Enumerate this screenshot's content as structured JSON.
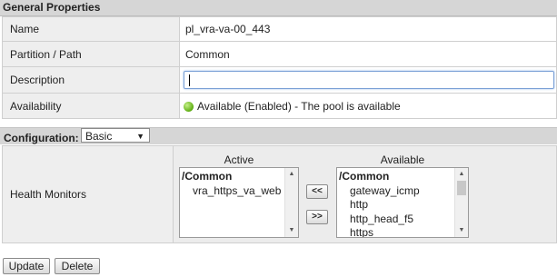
{
  "general": {
    "title": "General Properties",
    "rows": [
      {
        "label": "Name",
        "value": "pl_vra-va-00_443"
      },
      {
        "label": "Partition / Path",
        "value": "Common"
      },
      {
        "label": "Description",
        "value": ""
      },
      {
        "label": "Availability",
        "value": "Available (Enabled) - The pool is available"
      }
    ]
  },
  "configuration": {
    "label": "Configuration:",
    "mode": "Basic",
    "health_monitors": {
      "label": "Health Monitors",
      "active_title": "Active",
      "available_title": "Available",
      "active_items": [
        {
          "text": "/Common",
          "type": "group"
        },
        {
          "text": "vra_https_va_web",
          "type": "item"
        }
      ],
      "available_items": [
        {
          "text": "/Common",
          "type": "group"
        },
        {
          "text": "gateway_icmp",
          "type": "item"
        },
        {
          "text": "http",
          "type": "item"
        },
        {
          "text": "http_head_f5",
          "type": "item"
        },
        {
          "text": "https",
          "type": "item"
        }
      ],
      "move_left_label": "<<",
      "move_right_label": ">>"
    }
  },
  "actions": {
    "update_label": "Update",
    "delete_label": "Delete"
  },
  "colors": {
    "status_available": "#5fae12",
    "input_focus": "#7aa0d6",
    "header_bg": "#d6d6d6"
  }
}
